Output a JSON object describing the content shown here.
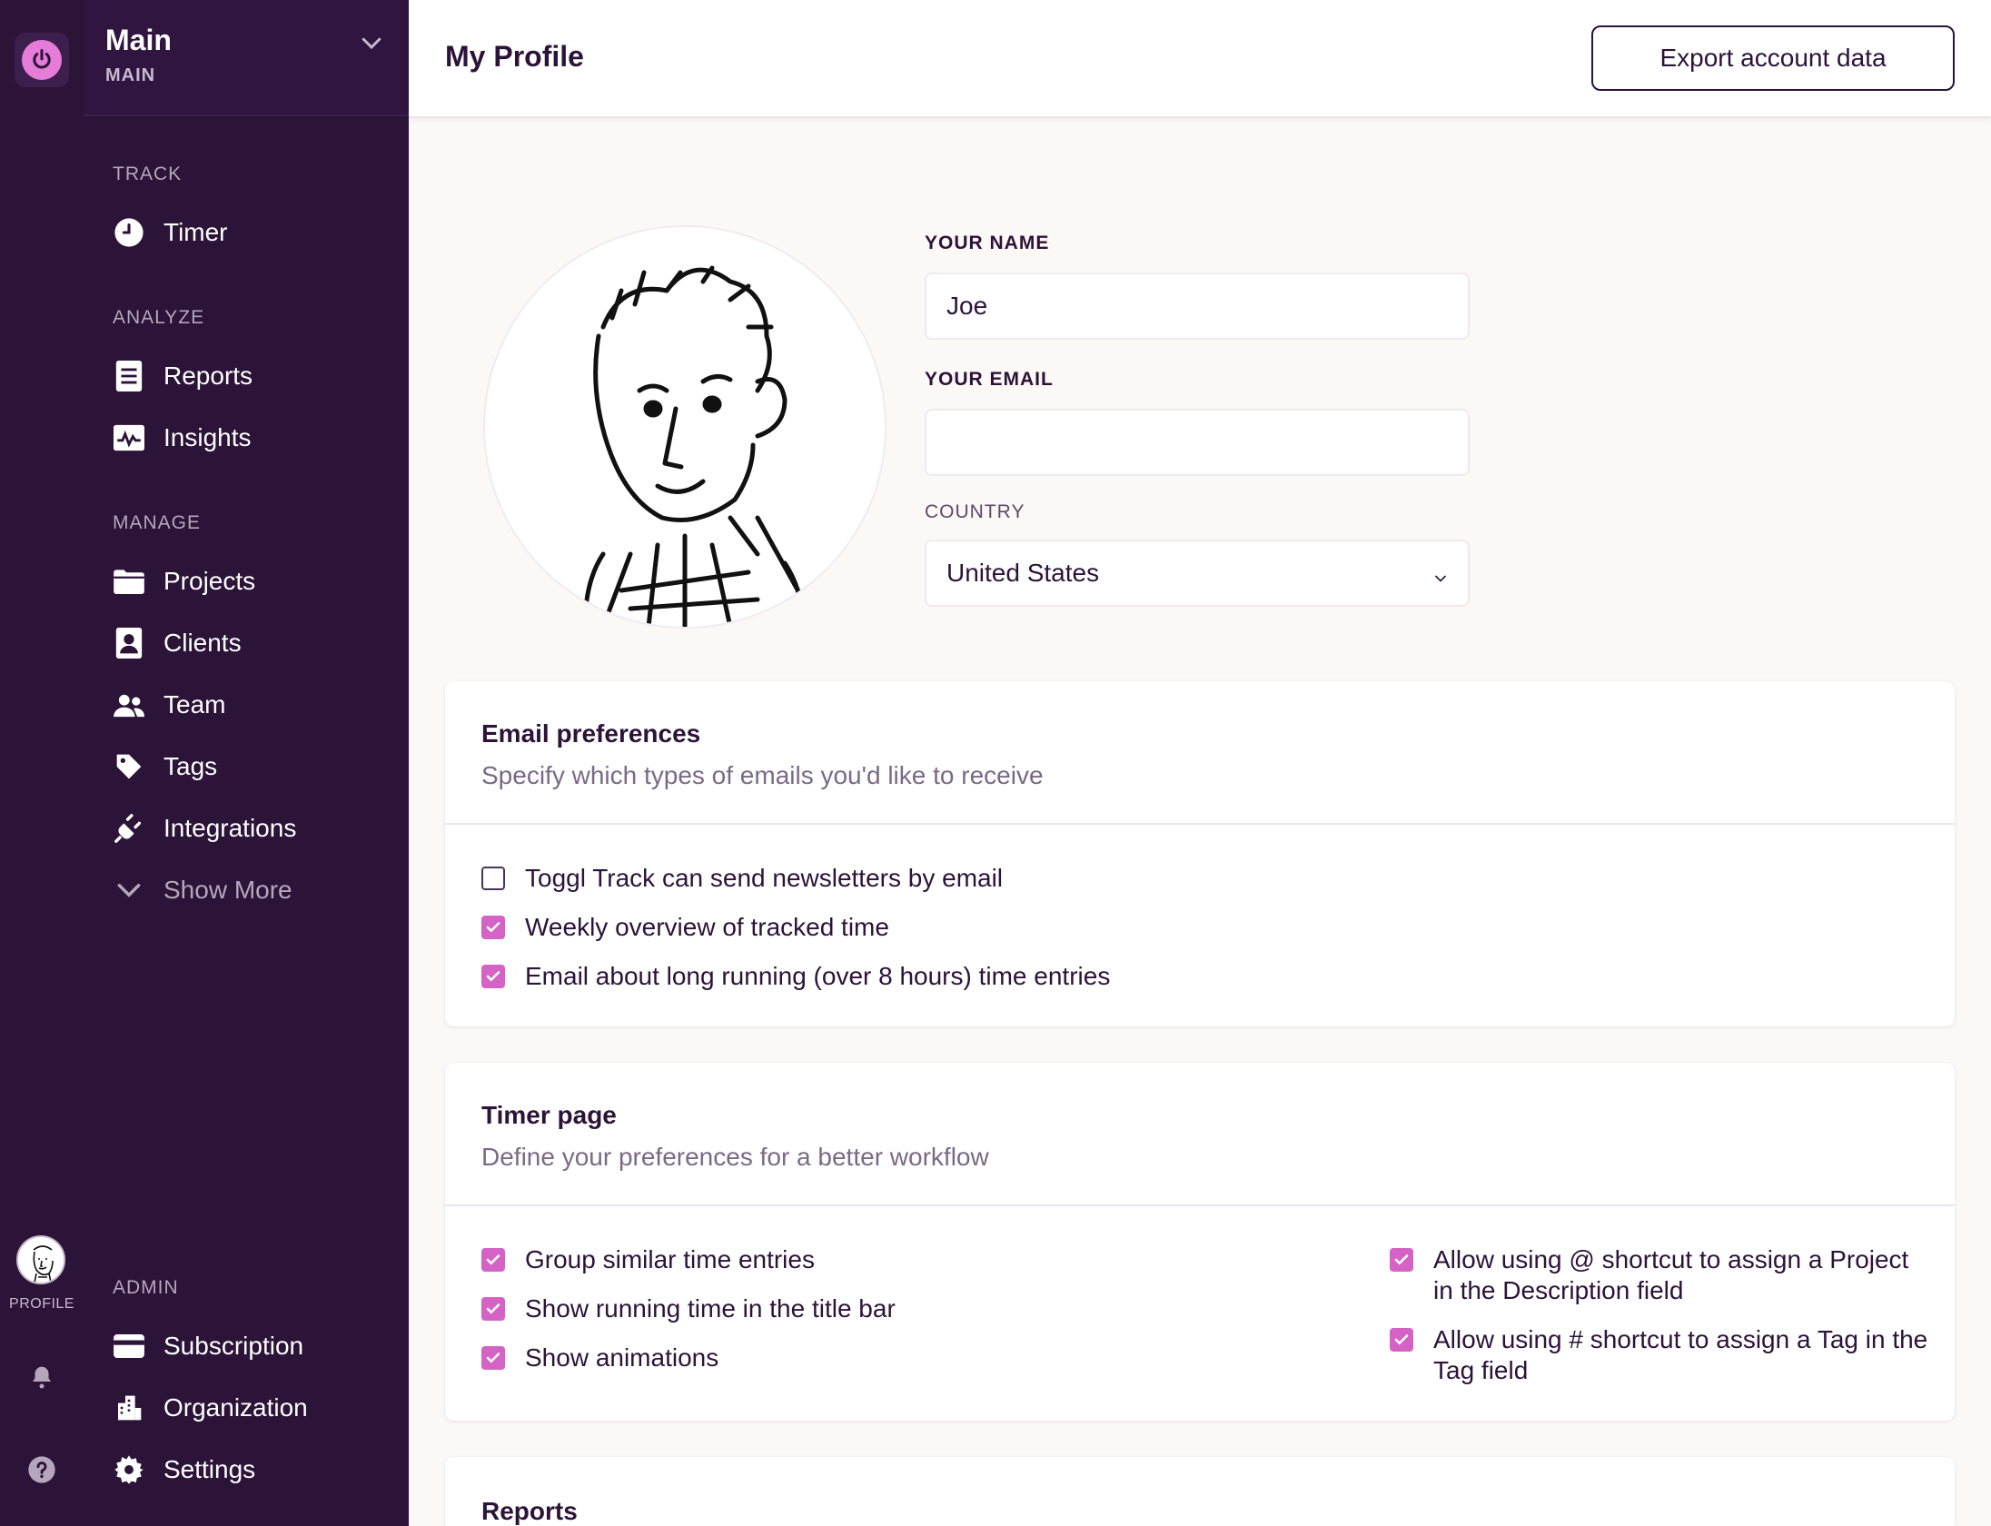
{
  "app": {
    "workspace_name": "Main",
    "workspace_sub": "MAIN",
    "page_title": "My Profile",
    "export_label": "Export account data"
  },
  "rail": {
    "profile_label": "PROFILE"
  },
  "sidebar": {
    "sections": {
      "track": "TRACK",
      "analyze": "ANALYZE",
      "manage": "MANAGE",
      "admin": "ADMIN"
    },
    "items": [
      {
        "label": "Timer",
        "icon": "clock-icon"
      },
      {
        "label": "Reports",
        "icon": "report-icon"
      },
      {
        "label": "Insights",
        "icon": "insights-icon"
      },
      {
        "label": "Projects",
        "icon": "folder-icon"
      },
      {
        "label": "Clients",
        "icon": "client-icon"
      },
      {
        "label": "Team",
        "icon": "team-icon"
      },
      {
        "label": "Tags",
        "icon": "tag-icon"
      },
      {
        "label": "Integrations",
        "icon": "plug-icon"
      },
      {
        "label": "Show More",
        "icon": "chevron-down-icon"
      },
      {
        "label": "Subscription",
        "icon": "card-icon"
      },
      {
        "label": "Organization",
        "icon": "building-icon"
      },
      {
        "label": "Settings",
        "icon": "gear-icon"
      }
    ]
  },
  "profile": {
    "name_label": "YOUR NAME",
    "name_value": "Joe",
    "email_label": "YOUR EMAIL",
    "email_value": "",
    "country_label": "COUNTRY",
    "country_value": "United States"
  },
  "email_prefs": {
    "title": "Email preferences",
    "subtitle": "Specify which types of emails you'd like to receive",
    "options": [
      {
        "label": "Toggl Track can send newsletters by email",
        "checked": false
      },
      {
        "label": "Weekly overview of tracked time",
        "checked": true
      },
      {
        "label": "Email about long running (over 8 hours) time entries",
        "checked": true
      }
    ]
  },
  "timer_page": {
    "title": "Timer page",
    "subtitle": "Define your preferences for a better workflow",
    "options_left": [
      {
        "label": "Group similar time entries",
        "checked": true
      },
      {
        "label": "Show running time in the title bar",
        "checked": true
      },
      {
        "label": "Show animations",
        "checked": true
      }
    ],
    "options_right": [
      {
        "label": "Allow using @ shortcut to assign a Project in the Description field",
        "checked": true
      },
      {
        "label": "Allow using # shortcut to assign a Tag in the Tag field",
        "checked": true
      }
    ]
  },
  "reports_card": {
    "title": "Reports"
  },
  "colors": {
    "sidebar_bg": "#2c1338",
    "accent": "#e57cd8",
    "checkbox": "#d563c6",
    "page_bg": "#fcf8f6"
  }
}
